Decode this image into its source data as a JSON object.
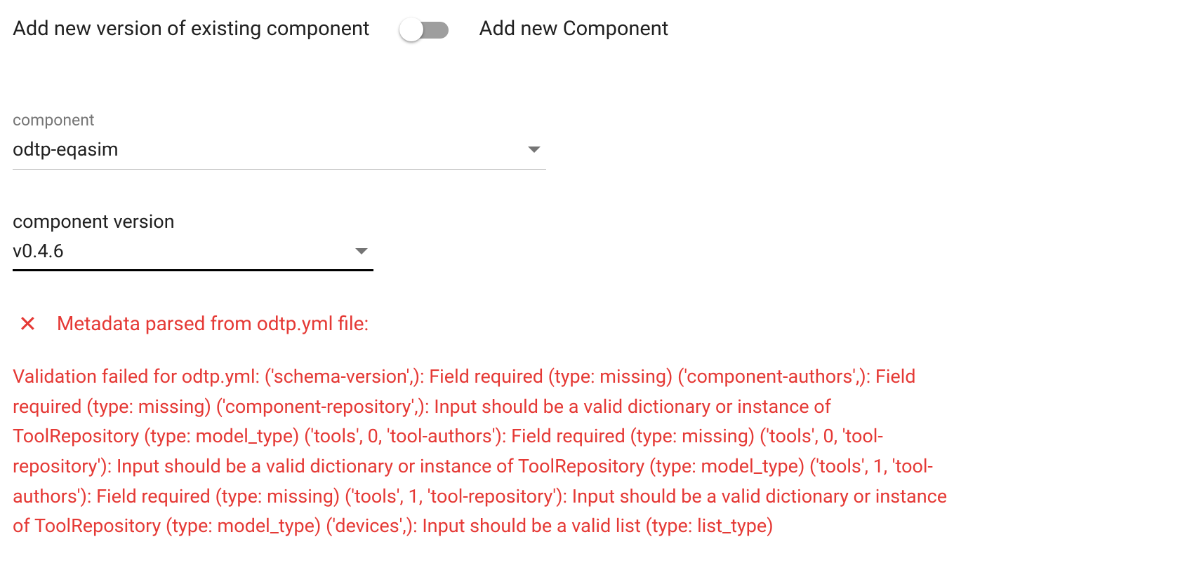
{
  "toggle": {
    "left_label": "Add new version of existing component",
    "right_label": "Add new Component",
    "state": "left"
  },
  "component_select": {
    "label": "component",
    "value": "odtp-eqasim"
  },
  "version_select": {
    "label": "component version",
    "value": "v0.4.6"
  },
  "error": {
    "icon": "close-icon",
    "title": "Metadata parsed from odtp.yml file:",
    "message": "Validation failed for odtp.yml: ('schema-version',): Field required (type: missing) ('component-authors',): Field required (type: missing) ('component-repository',): Input should be a valid dictionary or instance of ToolRepository (type: model_type) ('tools', 0, 'tool-authors'): Field required (type: missing) ('tools', 0, 'tool-repository'): Input should be a valid dictionary or instance of ToolRepository (type: model_type) ('tools', 1, 'tool-authors'): Field required (type: missing) ('tools', 1, 'tool-repository'): Input should be a valid dictionary or instance of ToolRepository (type: model_type) ('devices',): Input should be a valid list (type: list_type)"
  }
}
